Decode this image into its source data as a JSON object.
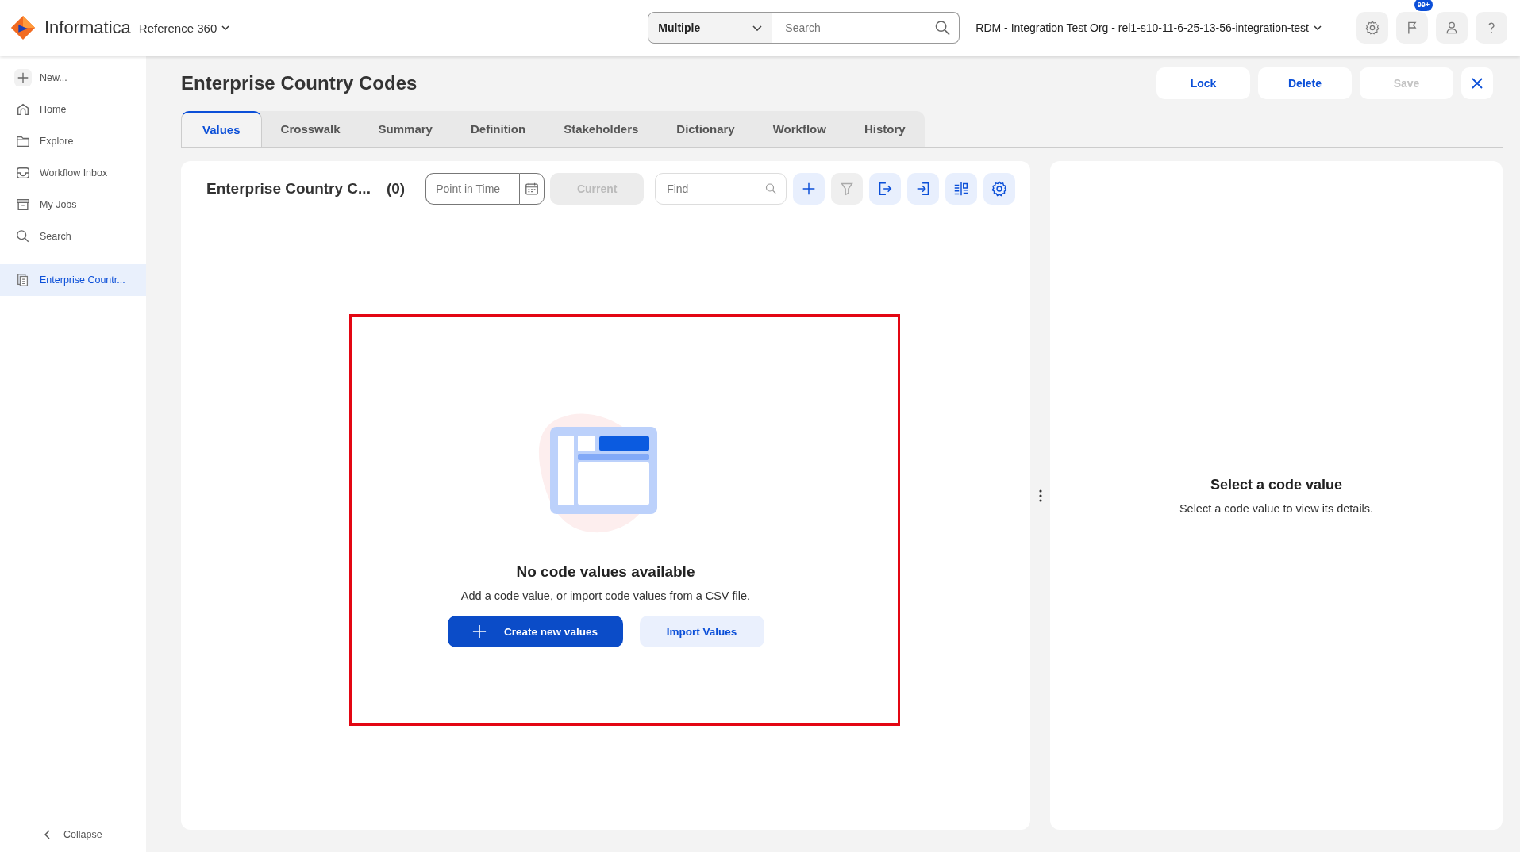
{
  "header": {
    "logo": "Informatica",
    "product": "Reference 360",
    "scope_select": "Multiple",
    "search": {
      "placeholder": "Search"
    },
    "org": "RDM - Integration Test Org - rel1-s10-11-6-25-13-56-integration-test",
    "notifications_badge": "99+"
  },
  "sidebar": {
    "items": [
      {
        "label": "New...",
        "kind": "new",
        "selected": false
      },
      {
        "label": "Home",
        "kind": "home",
        "selected": false
      },
      {
        "label": "Explore",
        "kind": "explore",
        "selected": false
      },
      {
        "label": "Workflow Inbox",
        "kind": "inbox",
        "selected": false
      },
      {
        "label": "My Jobs",
        "kind": "jobs",
        "selected": false
      },
      {
        "label": "Search",
        "kind": "search",
        "selected": false
      }
    ],
    "open_items": [
      {
        "label": "Enterprise Countr...",
        "selected": true
      }
    ],
    "collapse": "Collapse"
  },
  "page": {
    "title": "Enterprise Country Codes",
    "actions": [
      {
        "label": "Lock",
        "disabled": false
      },
      {
        "label": "Delete",
        "disabled": false
      },
      {
        "label": "Save",
        "disabled": true
      }
    ]
  },
  "tabs": [
    {
      "label": "Values",
      "selected": true
    },
    {
      "label": "Crosswalk",
      "selected": false
    },
    {
      "label": "Summary",
      "selected": false
    },
    {
      "label": "Definition",
      "selected": false
    },
    {
      "label": "Stakeholders",
      "selected": false
    },
    {
      "label": "Dictionary",
      "selected": false
    },
    {
      "label": "Workflow",
      "selected": false
    },
    {
      "label": "History",
      "selected": false
    }
  ],
  "values_panel": {
    "title": "Enterprise Country C...",
    "count": "(0)",
    "point_in_time": {
      "placeholder": "Point in Time"
    },
    "current": {
      "label": "Current",
      "disabled": true
    },
    "find": {
      "placeholder": "Find"
    },
    "tools": [
      {
        "kind": "add",
        "disabled": false
      },
      {
        "kind": "filter",
        "disabled": true
      },
      {
        "kind": "export",
        "disabled": false
      },
      {
        "kind": "import",
        "disabled": false
      },
      {
        "kind": "columns",
        "disabled": false
      },
      {
        "kind": "settings",
        "disabled": false
      }
    ]
  },
  "empty_state": {
    "title": "No code values available",
    "message": "Add a code value, or import code values from a CSV file.",
    "primary": "Create new values",
    "secondary": "Import Values"
  },
  "details": {
    "title": "Select a code value",
    "message": "Select a code value to view its details."
  }
}
